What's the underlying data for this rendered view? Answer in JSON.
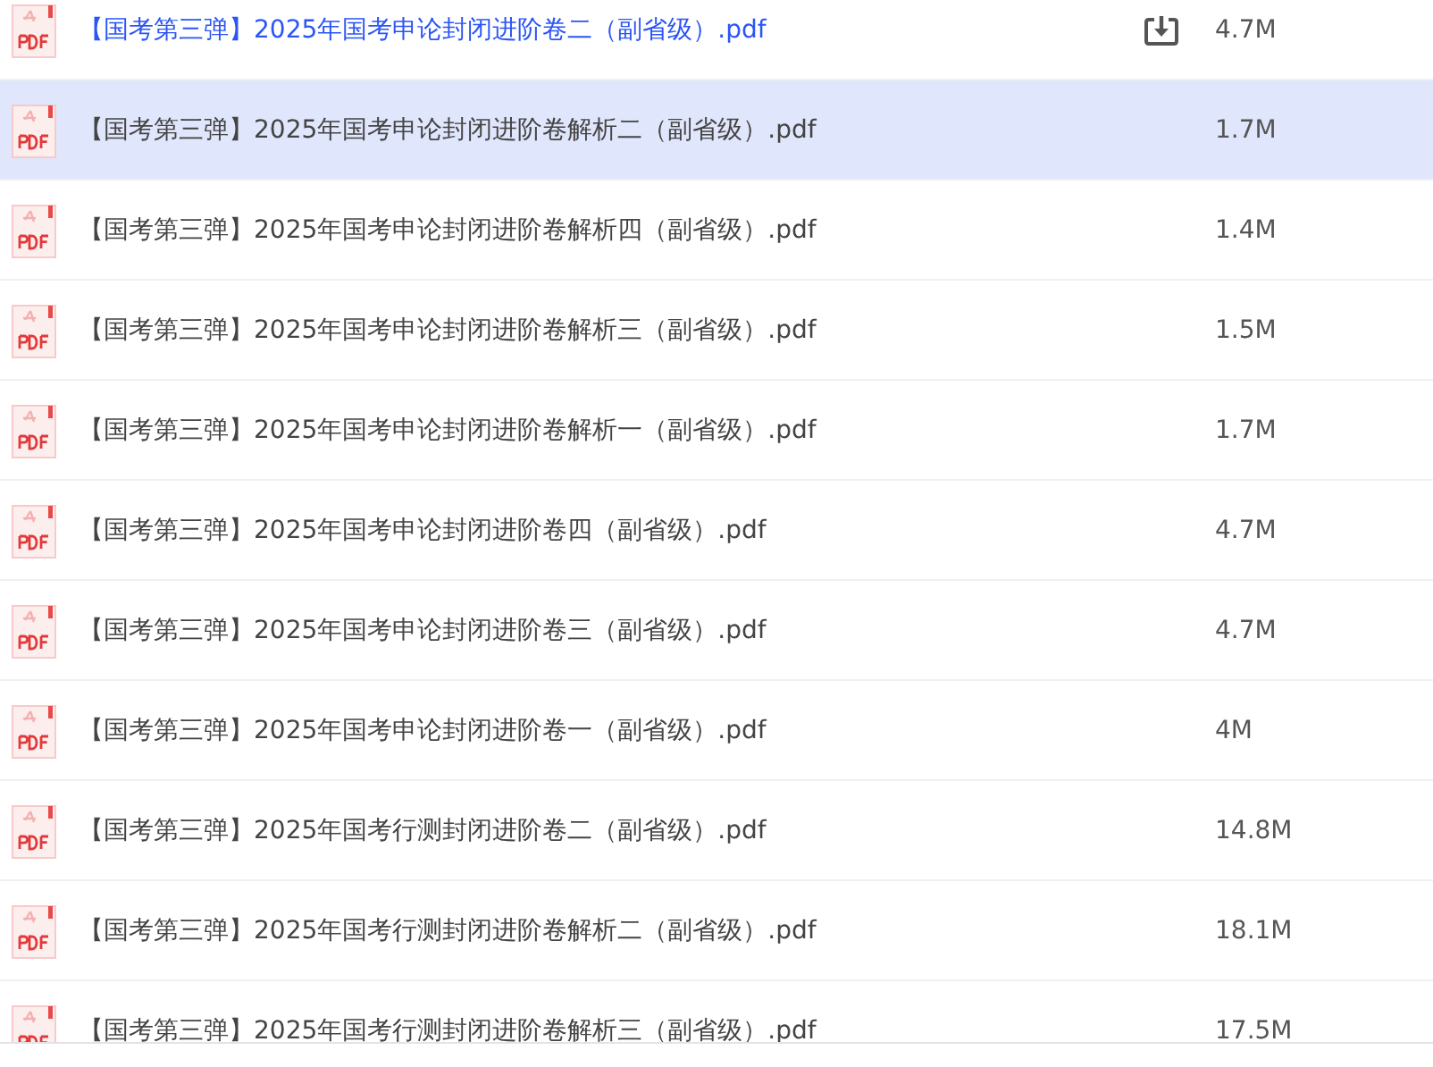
{
  "files": [
    {
      "name": "【国考第三弹】2025年国考申论封闭进阶卷二（副省级）.pdf",
      "size": "4.7M",
      "hovered": true,
      "selected": false
    },
    {
      "name": "【国考第三弹】2025年国考申论封闭进阶卷解析二（副省级）.pdf",
      "size": "1.7M",
      "hovered": false,
      "selected": true
    },
    {
      "name": "【国考第三弹】2025年国考申论封闭进阶卷解析四（副省级）.pdf",
      "size": "1.4M",
      "hovered": false,
      "selected": false
    },
    {
      "name": "【国考第三弹】2025年国考申论封闭进阶卷解析三（副省级）.pdf",
      "size": "1.5M",
      "hovered": false,
      "selected": false
    },
    {
      "name": "【国考第三弹】2025年国考申论封闭进阶卷解析一（副省级）.pdf",
      "size": "1.7M",
      "hovered": false,
      "selected": false
    },
    {
      "name": "【国考第三弹】2025年国考申论封闭进阶卷四（副省级）.pdf",
      "size": "4.7M",
      "hovered": false,
      "selected": false
    },
    {
      "name": "【国考第三弹】2025年国考申论封闭进阶卷三（副省级）.pdf",
      "size": "4.7M",
      "hovered": false,
      "selected": false
    },
    {
      "name": "【国考第三弹】2025年国考申论封闭进阶卷一（副省级）.pdf",
      "size": "4M",
      "hovered": false,
      "selected": false
    },
    {
      "name": "【国考第三弹】2025年国考行测封闭进阶卷二（副省级）.pdf",
      "size": "14.8M",
      "hovered": false,
      "selected": false
    },
    {
      "name": "【国考第三弹】2025年国考行测封闭进阶卷解析二（副省级）.pdf",
      "size": "18.1M",
      "hovered": false,
      "selected": false
    },
    {
      "name": "【国考第三弹】2025年国考行测封闭进阶卷解析三（副省级）.pdf",
      "size": "17.5M",
      "hovered": false,
      "selected": false
    }
  ]
}
